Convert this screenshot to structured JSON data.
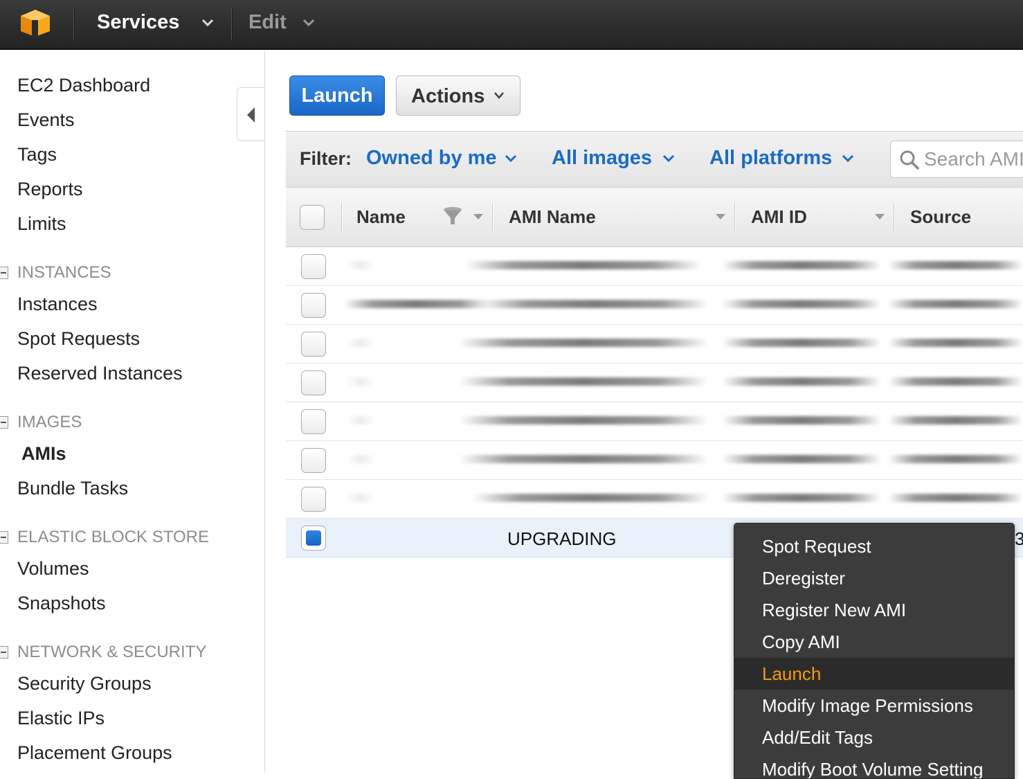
{
  "topnav": {
    "services_label": "Services",
    "edit_label": "Edit",
    "logo_color": "#f5a623"
  },
  "sidebar": {
    "top_links": [
      "EC2 Dashboard",
      "Events",
      "Tags",
      "Reports",
      "Limits"
    ],
    "sections": [
      {
        "heading": "INSTANCES",
        "items": [
          "Instances",
          "Spot Requests",
          "Reserved Instances"
        ]
      },
      {
        "heading": "IMAGES",
        "items": [
          "AMIs",
          "Bundle Tasks"
        ]
      },
      {
        "heading": "ELASTIC BLOCK STORE",
        "items": [
          "Volumes",
          "Snapshots"
        ]
      },
      {
        "heading": "NETWORK & SECURITY",
        "items": [
          "Security Groups",
          "Elastic IPs",
          "Placement Groups"
        ]
      }
    ],
    "active_item": "AMIs"
  },
  "toolbar": {
    "launch_label": "Launch",
    "actions_label": "Actions"
  },
  "filter": {
    "label": "Filter:",
    "owner": "Owned by me",
    "images": "All images",
    "platforms": "All platforms",
    "search_placeholder": "Search AMIs"
  },
  "table": {
    "columns": [
      "Name",
      "AMI Name",
      "AMI ID",
      "Source"
    ],
    "selected_row": {
      "ami_name": "UPGRADING",
      "overflow_char": "3"
    }
  },
  "context_menu": {
    "items": [
      "Spot Request",
      "Deregister",
      "Register New AMI",
      "Copy AMI",
      "Launch",
      "Modify Image Permissions",
      "Add/Edit Tags",
      "Modify Boot Volume Setting"
    ],
    "highlighted": "Launch",
    "highlight_color": "#f39c12"
  }
}
